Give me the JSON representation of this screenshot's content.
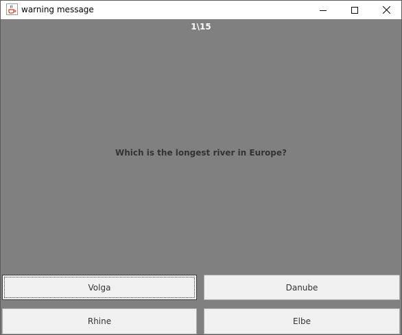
{
  "window": {
    "title": "warning message",
    "app_icon": "java-coffee-cup-icon",
    "controls": [
      "minimize-icon",
      "maximize-icon",
      "close-icon"
    ]
  },
  "quiz": {
    "counter": "1\\15",
    "question": "Which is the longest river in Europe?",
    "answers": [
      "Volga",
      "Danube",
      "Rhine",
      "Elbe"
    ],
    "focused_answer": "Volga"
  },
  "colors": {
    "background": "#808080",
    "button_face": "#f0f0f0",
    "counter_text": "#ffffff",
    "question_text": "#333333"
  }
}
